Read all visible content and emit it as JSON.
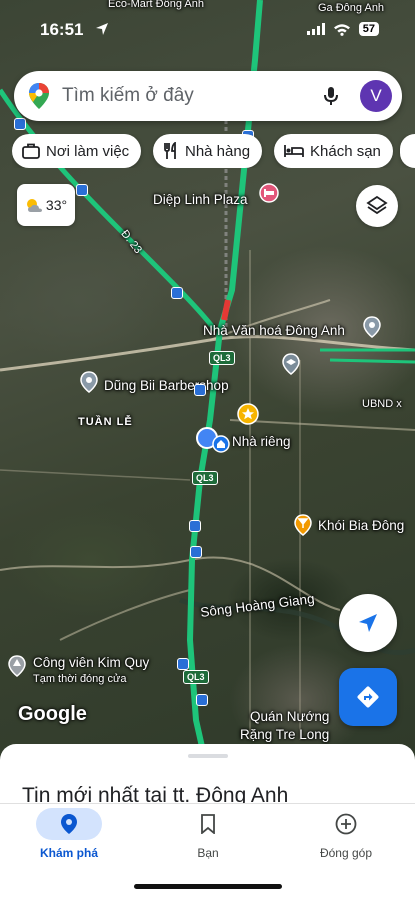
{
  "status_bar": {
    "time": "16:51",
    "battery": "57"
  },
  "search": {
    "placeholder": "Tìm kiếm ở đây",
    "avatar_letter": "V"
  },
  "chips": [
    {
      "icon": "briefcase-icon",
      "label": "Nơi làm việc"
    },
    {
      "icon": "restaurant-icon",
      "label": "Nhà hàng"
    },
    {
      "icon": "bed-icon",
      "label": "Khách sạn"
    }
  ],
  "weather": {
    "icon": "partly-sunny-icon",
    "temp": "33°"
  },
  "map_labels": {
    "eco_mart": "Eco-Mart Đông Anh",
    "ga_dong_anh": "Ga Đông Anh",
    "diep_linh": "Diệp Linh Plaza",
    "road_d23": "Đ. 23",
    "nha_van_hoa": "Nhà Văn hoá Đông Anh",
    "ql3_a": "QL3",
    "ql3_b": "QL3",
    "ql3_c": "QL3",
    "barbershop": "Dũng Bii Barbershop",
    "ubnd": "UBND x",
    "tuan_le": "TUẦN LỄ",
    "nha_rieng": "Nhà riêng",
    "khoi_bia": "Khói Bia Đông",
    "song_hoang_giang": "Sông Hoàng Giang",
    "cong_vien": "Công viên Kim Quy",
    "cong_vien_sub": "Tạm thời đóng cửa",
    "quan_nuong_1": "Quán Nướng",
    "quan_nuong_2": "Rặng Tre Long",
    "google": "Google"
  },
  "sheet": {
    "title": "Tin mới nhất tại tt. Đông Anh"
  },
  "nav": [
    {
      "icon": "explore-pin-icon",
      "label": "Khám phá",
      "active": true
    },
    {
      "icon": "bookmark-icon",
      "label": "Bạn",
      "active": false
    },
    {
      "icon": "add-circle-icon",
      "label": "Đóng góp",
      "active": false
    }
  ],
  "colors": {
    "accent": "#1a73e8",
    "route": "#1ec47a",
    "avatar": "#5e35b1",
    "nav_active_bg": "#d3e3fd"
  }
}
